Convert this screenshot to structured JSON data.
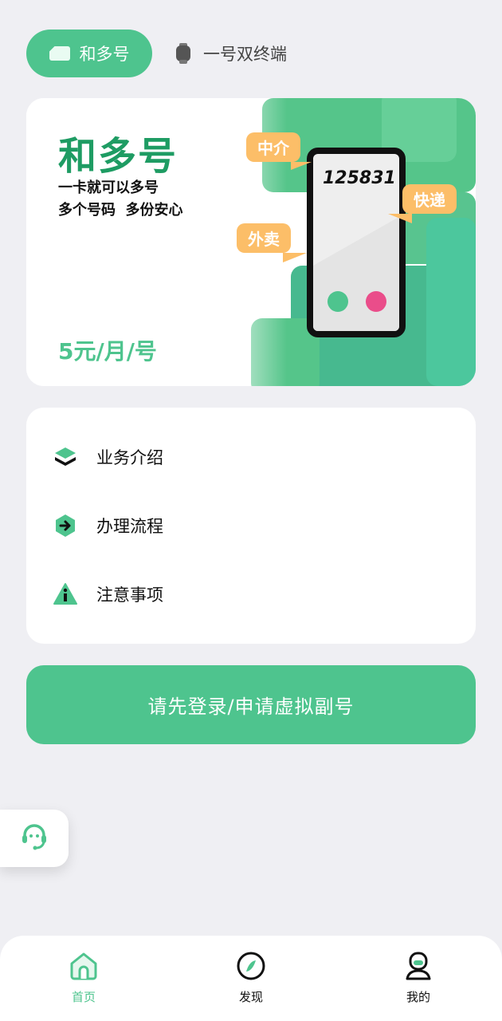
{
  "top_tabs": {
    "active_label": "和多号",
    "inactive_label": "一号双终端"
  },
  "banner": {
    "title": "和多号",
    "subtitle_line1": "一卡就可以多号",
    "subtitle_line2": "多个号码  多份安心",
    "price": "5元/月/号",
    "phone_number": "125831",
    "bubbles": [
      "中介",
      "外卖",
      "快递"
    ]
  },
  "menu": {
    "items": [
      {
        "label": "业务介绍",
        "icon": "layers-icon"
      },
      {
        "label": "办理流程",
        "icon": "arrow-right-hexagon-icon"
      },
      {
        "label": "注意事项",
        "icon": "info-triangle-icon"
      }
    ]
  },
  "login_button": {
    "label": "请先登录/申请虚拟副号"
  },
  "bottom_nav": {
    "items": [
      {
        "label": "首页",
        "icon": "home-icon",
        "active": true
      },
      {
        "label": "发现",
        "icon": "compass-icon",
        "active": false
      },
      {
        "label": "我的",
        "icon": "user-icon",
        "active": false
      }
    ]
  },
  "colors": {
    "accent": "#4ec48e",
    "accent_dark": "#1e9c63",
    "bubble": "#fcbe68",
    "background": "#efeff3",
    "pink_dot": "#ea4d8a"
  }
}
